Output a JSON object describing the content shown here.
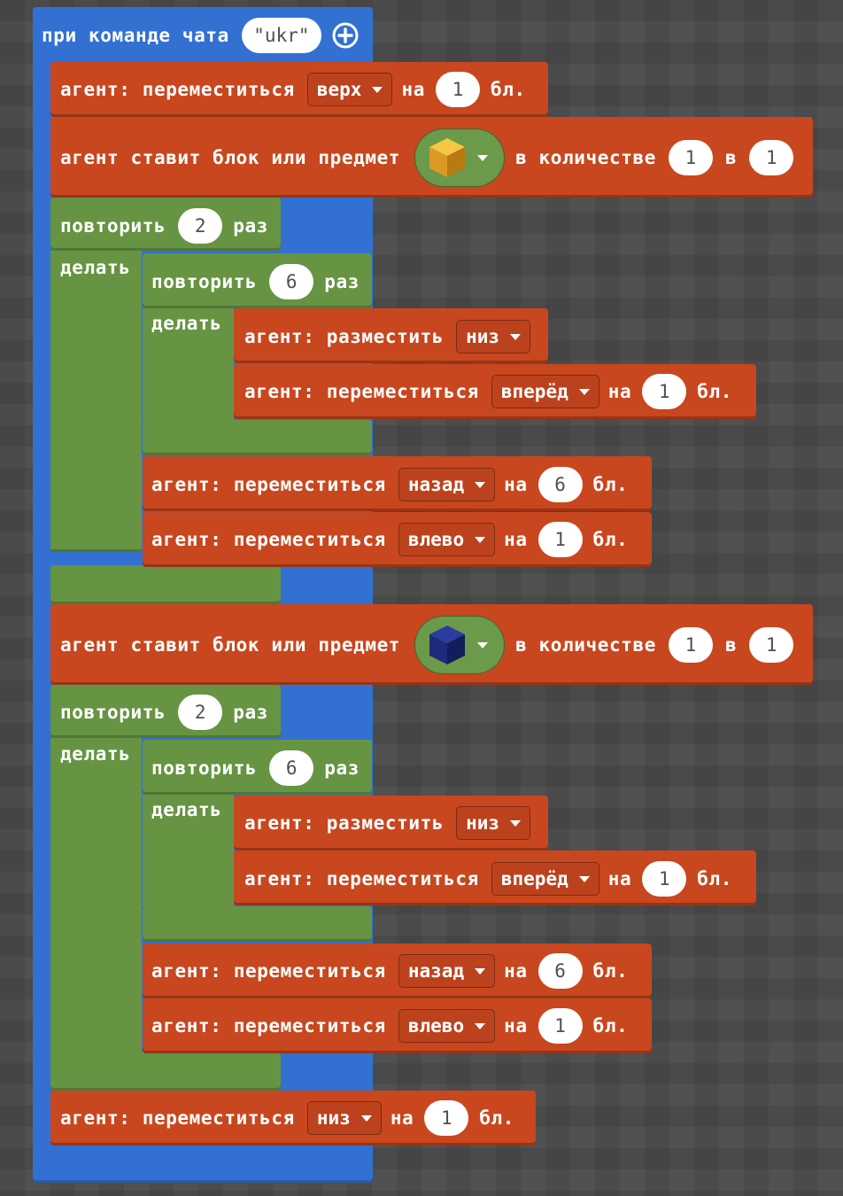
{
  "event": {
    "label": "при команде чата",
    "command": "\"ukr\"",
    "add_icon": "plus-circle-icon"
  },
  "colors": {
    "event_block": "#3271d2",
    "agent_block": "#c8471f",
    "loop_block": "#669443",
    "background": "#4a4a4a"
  },
  "move_up": {
    "label": "агент: переместиться",
    "direction": "верх",
    "na": "на",
    "amount": "1",
    "unit": "бл."
  },
  "place1": {
    "label": "агент ставит блок или предмет",
    "item_icon": "gold-block-icon",
    "qty_label": "в количестве",
    "qty": "1",
    "in_label": "в",
    "slot": "1"
  },
  "loop1": {
    "repeat_label": "повторить",
    "count": "2",
    "times": "раз",
    "do_label": "делать",
    "inner": {
      "repeat_label": "повторить",
      "count": "6",
      "times": "раз",
      "do_label": "делать",
      "place_label": "агент: разместить",
      "place_dir": "низ",
      "move_label": "агент: переместиться",
      "move_dir": "вперёд",
      "na": "на",
      "amount": "1",
      "unit": "бл."
    },
    "back": {
      "label": "агент: переместиться",
      "dir": "назад",
      "na": "на",
      "amount": "6",
      "unit": "бл."
    },
    "left": {
      "label": "агент: переместиться",
      "dir": "влево",
      "na": "на",
      "amount": "1",
      "unit": "бл."
    }
  },
  "place2": {
    "label": "агент ставит блок или предмет",
    "item_icon": "lapis-block-icon",
    "qty_label": "в количестве",
    "qty": "1",
    "in_label": "в",
    "slot": "1"
  },
  "loop2": {
    "repeat_label": "повторить",
    "count": "2",
    "times": "раз",
    "do_label": "делать",
    "inner": {
      "repeat_label": "повторить",
      "count": "6",
      "times": "раз",
      "do_label": "делать",
      "place_label": "агент: разместить",
      "place_dir": "низ",
      "move_label": "агент: переместиться",
      "move_dir": "вперёд",
      "na": "на",
      "amount": "1",
      "unit": "бл."
    },
    "back": {
      "label": "агент: переместиться",
      "dir": "назад",
      "na": "на",
      "amount": "6",
      "unit": "бл."
    },
    "left": {
      "label": "агент: переместиться",
      "dir": "влево",
      "na": "на",
      "amount": "1",
      "unit": "бл."
    }
  },
  "move_down": {
    "label": "агент: переместиться",
    "direction": "низ",
    "na": "на",
    "amount": "1",
    "unit": "бл."
  }
}
